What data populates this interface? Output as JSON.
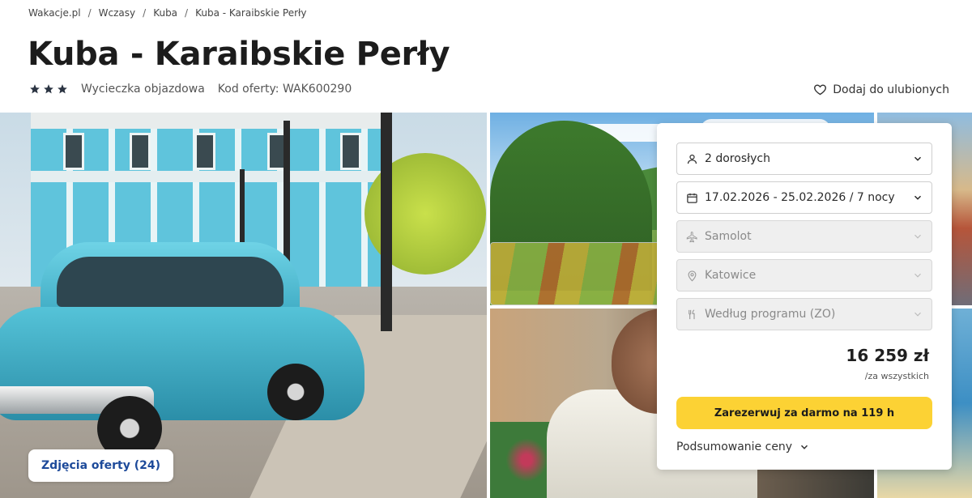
{
  "breadcrumb": [
    {
      "label": "Wakacje.pl"
    },
    {
      "label": "Wczasy"
    },
    {
      "label": "Kuba"
    },
    {
      "label": "Kuba - Karaibskie Perły"
    }
  ],
  "offer": {
    "title": "Kuba - Karaibskie Perły",
    "stars": 3,
    "kind": "Wycieczka objazdowa",
    "code_label": "Kod oferty: WAK600290",
    "favorite_label": "Dodaj do ulubionych"
  },
  "gallery": {
    "photos_button": "Zdjęcia oferty (24)"
  },
  "booking": {
    "guests": "2 dorosłych",
    "dates": "17.02.2026 - 25.02.2026 / 7 nocy",
    "transport": "Samolot",
    "departure": "Katowice",
    "board": "Według programu (ZO)",
    "price": "16 259 zł",
    "price_note": "/za wszystkich",
    "book_button": "Zarezerwuj za darmo na 119 h",
    "summary_link": "Podsumowanie ceny"
  },
  "colors": {
    "accent_yellow": "#fcd234",
    "link_blue": "#1d4a9a",
    "star": "#2b3442"
  }
}
